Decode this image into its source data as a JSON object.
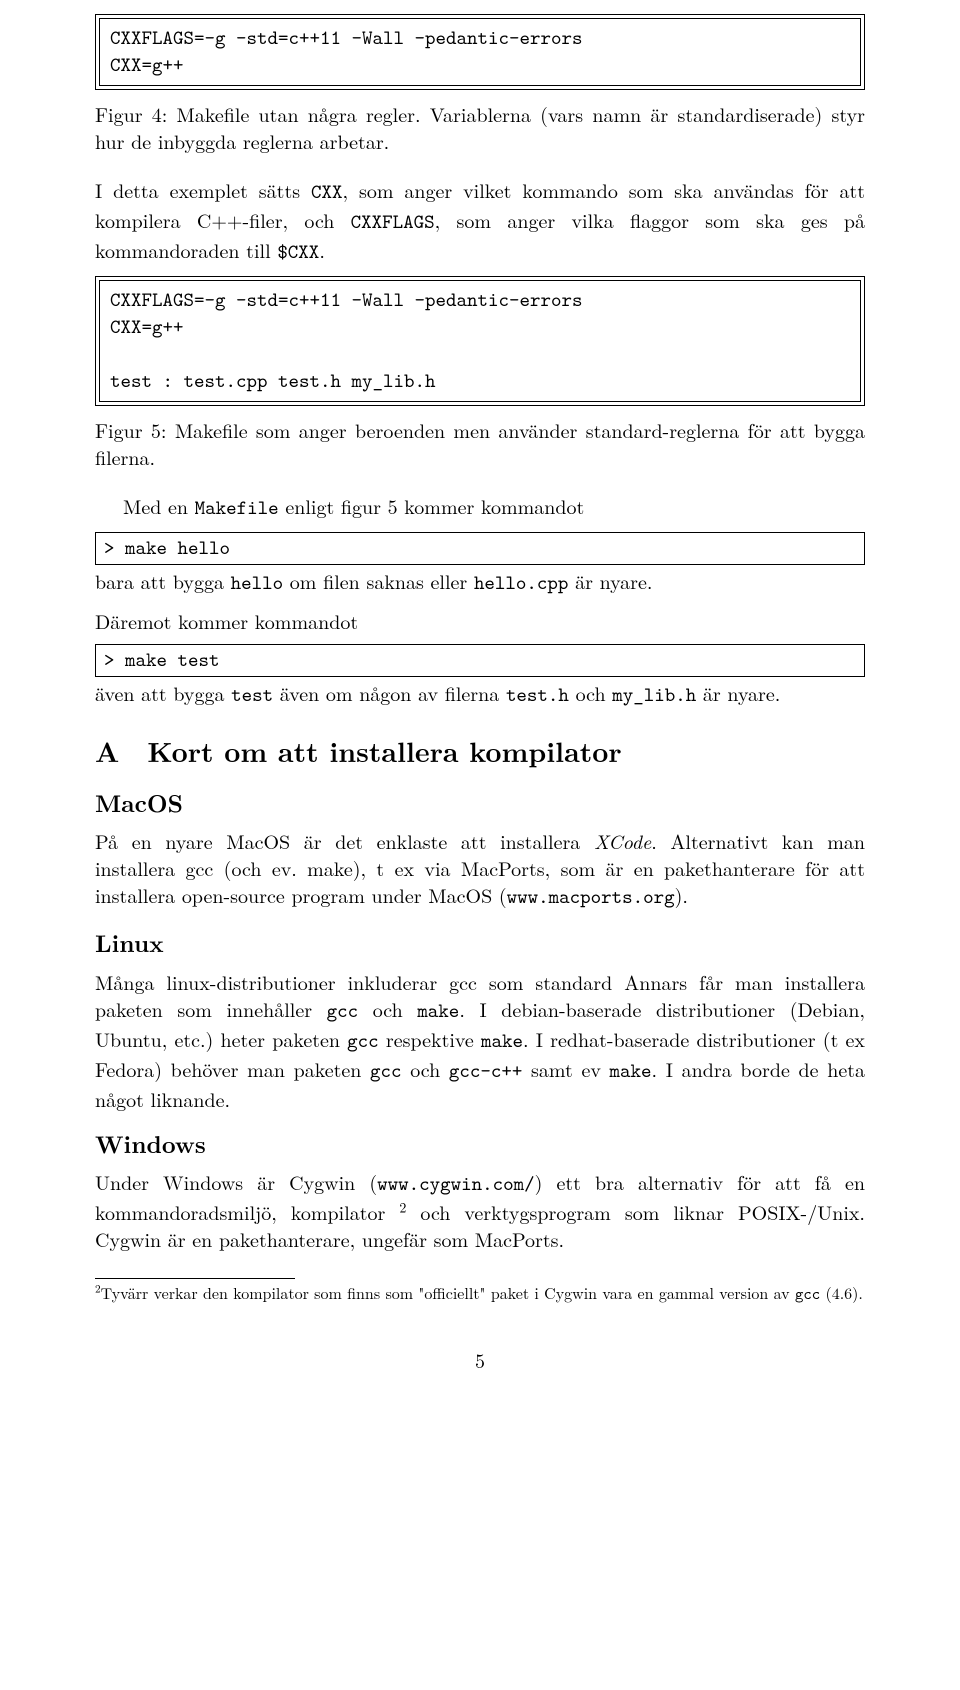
{
  "codebox1": "CXXFLAGS=-g -std=c++11 -Wall -pedantic-errors\nCXX=g++",
  "fig4_caption": "Figur 4: Makefile utan några regler. Variablerna (vars namn är standardiserade) styr hur de inbyggda reglerna arbetar.",
  "para1_a": "I detta exemplet sätts ",
  "para1_code1": "CXX",
  "para1_b": ", som anger vilket kommando som ska användas för att kompilera C++-filer, och ",
  "para1_code2": "CXXFLAGS",
  "para1_c": ", som anger vilka flaggor som ska ges på kommandoraden till ",
  "para1_code3": "$CXX",
  "para1_d": ".",
  "codebox2": "CXXFLAGS=-g -std=c++11 -Wall -pedantic-errors\nCXX=g++\n\ntest : test.cpp test.h my_lib.h",
  "fig5_caption": "Figur 5: Makefile som anger beroenden men använder standard-reglerna för att bygga filerna.",
  "para2_a": "Med en ",
  "para2_code1": "Makefile",
  "para2_b": " enligt figur 5 kommer kommandot",
  "cmd1": "> make hello",
  "para3_a": "bara att bygga ",
  "para3_code1": "hello",
  "para3_b": " om filen saknas eller ",
  "para3_code2": "hello.cpp",
  "para3_c": " är nyare.",
  "para4": "Däremot kommer kommandot",
  "cmd2": "> make test",
  "para5_a": "även att bygga ",
  "para5_code1": "test",
  "para5_b": " även om någon av filerna ",
  "para5_code2": "test.h",
  "para5_c": " och ",
  "para5_code3": "my_lib.h",
  "para5_d": " är nyare.",
  "appendix_heading": "A Kort om att installera kompilator",
  "sub_macos": "MacOS",
  "macos_a": "På en nyare MacOS är det enklaste att installera ",
  "macos_italic": "XCode",
  "macos_b": ". Alternativt kan man installera gcc (och ev. make), t ex via MacPorts, som är en pakethanterare för att installera open-source program under MacOS (",
  "macos_code": "www.macports.org",
  "macos_c": ").",
  "sub_linux": "Linux",
  "linux_a": "Många linux-distributioner inkluderar gcc som standard Annars får man installera paketen som innehåller ",
  "linux_code1": "gcc",
  "linux_b": " och ",
  "linux_code2": "make",
  "linux_c": ". I debian-baserade distributioner (Debian, Ubuntu, etc.) heter paketen ",
  "linux_code3": "gcc",
  "linux_d": " respektive ",
  "linux_code4": "make",
  "linux_e": ". I redhat-baserade distributioner (t ex Fedora) behöver man paketen ",
  "linux_code5": "gcc",
  "linux_f": " och ",
  "linux_code6": "gcc-c++",
  "linux_g": " samt ev ",
  "linux_code7": "make",
  "linux_h": ". I andra borde de heta något liknande.",
  "sub_windows": "Windows",
  "win_a": "Under Windows är Cygwin (",
  "win_code1": "www.cygwin.com/",
  "win_b": ") ett bra alternativ för att få en kommandoradsmiljö, kompilator ",
  "win_sup": "2",
  "win_c": " och verktygsprogram som liknar POSIX-/Unix. Cygwin är en pakethanterare, ungefär som MacPorts.",
  "footnote_sup": "2",
  "footnote_a": "Tyvärr verkar den kompilator som finns som \"officiellt\" paket i Cygwin vara en gammal version av ",
  "footnote_code": "gcc",
  "footnote_b": " (4.6).",
  "pagenum": "5"
}
